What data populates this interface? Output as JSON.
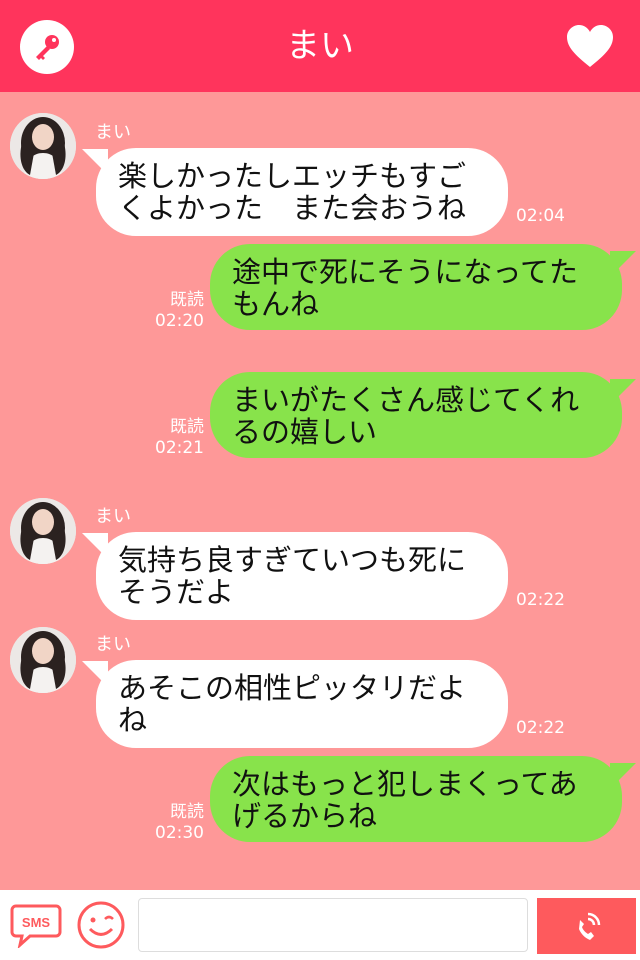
{
  "header": {
    "title": "まい"
  },
  "messages": [
    {
      "sender": "まい",
      "text_line1": "楽しかったしエッチもすご",
      "text_line2": "くよかった　また会おうね",
      "time": "02:04"
    },
    {
      "read": "既読",
      "text_line1": "途中で死にそうになってた",
      "text_line2": "もんね",
      "time": "02:20"
    },
    {
      "read": "既読",
      "text_line1": "まいがたくさん感じてくれ",
      "text_line2": "るの嬉しい",
      "time": "02:21"
    },
    {
      "sender": "まい",
      "text_line1": "気持ち良すぎていつも死に",
      "text_line2": "そうだよ",
      "time": "02:22"
    },
    {
      "sender": "まい",
      "text_line1": "あそこの相性ピッタリだよ",
      "text_line2": "ね",
      "time": "02:22"
    },
    {
      "read": "既読",
      "text_line1": "次はもっと犯しまくってあ",
      "text_line2": "げるからね",
      "time": "02:30"
    }
  ],
  "footer": {
    "sms_label": "SMS",
    "input_placeholder": ""
  },
  "icons": {
    "key": "key-icon",
    "heart": "heart-icon",
    "sms": "sms-icon",
    "emoji": "smiley-icon",
    "call": "phone-icon"
  },
  "colors": {
    "header": "#ff345c",
    "background": "#fe9898",
    "incoming": "#ffffff",
    "outgoing": "#88e34b",
    "call": "#fe5a5d"
  }
}
